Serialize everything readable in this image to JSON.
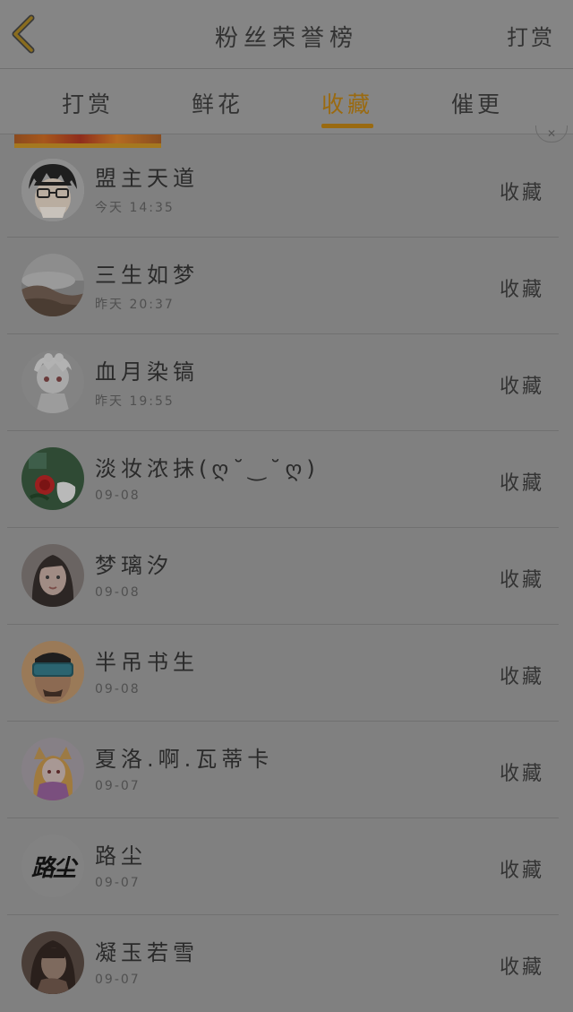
{
  "header": {
    "title": "粉丝荣誉榜",
    "right_action": "打赏"
  },
  "tabs": [
    {
      "label": "打赏"
    },
    {
      "label": "鲜花"
    },
    {
      "label": "收藏"
    },
    {
      "label": "催更"
    }
  ],
  "active_tab": "收藏",
  "colors": {
    "accent": "#9a6a10",
    "background": "#808080"
  },
  "rows": [
    {
      "name": "盟主天道",
      "time": "今天 14:35",
      "action": "收藏",
      "avatar_icon": "glasses-boy-avatar"
    },
    {
      "name": "三生如梦",
      "time": "昨天 20:37",
      "action": "收藏",
      "avatar_icon": "landscape-avatar"
    },
    {
      "name": "血月染镐",
      "time": "昨天 19:55",
      "action": "收藏",
      "avatar_icon": "anime-girl-avatar"
    },
    {
      "name": "淡妆浓抹(ღ˘‿˘ღ)",
      "time": "09-08",
      "action": "收藏",
      "avatar_icon": "red-rose-avatar"
    },
    {
      "name": "梦璃汐",
      "time": "09-08",
      "action": "收藏",
      "avatar_icon": "girl-portrait-avatar"
    },
    {
      "name": "半吊书生",
      "time": "09-08",
      "action": "收藏",
      "avatar_icon": "man-goggles-avatar"
    },
    {
      "name": "夏洛.啊.瓦蒂卡",
      "time": "09-07",
      "action": "收藏",
      "avatar_icon": "anime-fox-girl-avatar"
    },
    {
      "name": "路尘",
      "time": "09-07",
      "action": "收藏",
      "avatar_icon": "calligraphy-avatar",
      "avatar_text": "路尘"
    },
    {
      "name": "凝玉若雪",
      "time": "09-07",
      "action": "收藏",
      "avatar_icon": "dark-portrait-avatar"
    }
  ]
}
